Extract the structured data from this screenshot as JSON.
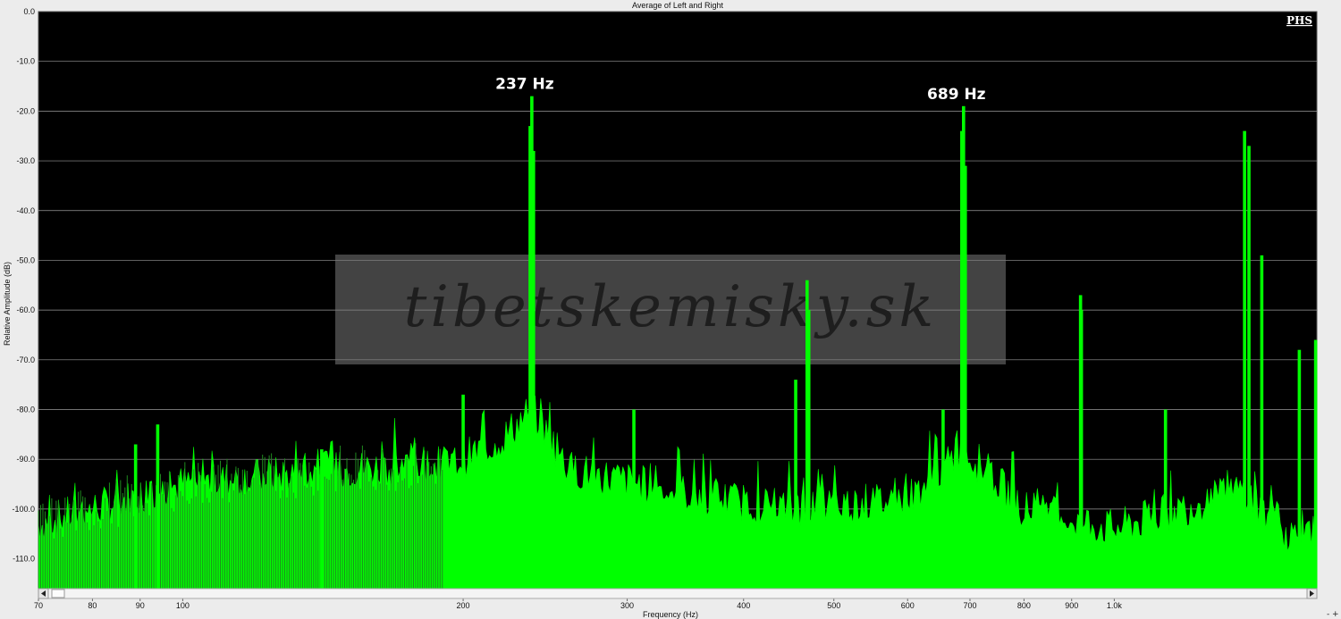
{
  "chart_data": {
    "type": "area",
    "title": "Average of Left and Right",
    "xlabel": "Frequency (Hz)",
    "ylabel": "Relative Amplitude (dB)",
    "x_scale": "log",
    "xlim": [
      70,
      1650
    ],
    "ylim": [
      -116,
      0
    ],
    "grid": true,
    "series_color": "#00ff00",
    "x_ticks": [
      {
        "value": 70,
        "label": "70"
      },
      {
        "value": 80,
        "label": "80"
      },
      {
        "value": 90,
        "label": "90"
      },
      {
        "value": 100,
        "label": "100"
      },
      {
        "value": 200,
        "label": "200"
      },
      {
        "value": 300,
        "label": "300"
      },
      {
        "value": 400,
        "label": "400"
      },
      {
        "value": 500,
        "label": "500"
      },
      {
        "value": 600,
        "label": "600"
      },
      {
        "value": 700,
        "label": "700"
      },
      {
        "value": 800,
        "label": "800"
      },
      {
        "value": 900,
        "label": "900"
      },
      {
        "value": 1000,
        "label": "1.0k"
      }
    ],
    "y_ticks": [
      {
        "value": 0,
        "label": "0.0"
      },
      {
        "value": -10,
        "label": "-10.0"
      },
      {
        "value": -20,
        "label": "-20.0"
      },
      {
        "value": -30,
        "label": "-30.0"
      },
      {
        "value": -40,
        "label": "-40.0"
      },
      {
        "value": -50,
        "label": "-50.0"
      },
      {
        "value": -60,
        "label": "-60.0"
      },
      {
        "value": -70,
        "label": "-70.0"
      },
      {
        "value": -80,
        "label": "-80.0"
      },
      {
        "value": -90,
        "label": "-90.0"
      },
      {
        "value": -100,
        "label": "-100.0"
      },
      {
        "value": -110,
        "label": "-110.0"
      }
    ],
    "peaks": [
      {
        "freq": 200,
        "db": -77
      },
      {
        "freq": 237,
        "db": -17
      },
      {
        "freq": 236,
        "db": -23
      },
      {
        "freq": 238,
        "db": -28
      },
      {
        "freq": 305,
        "db": -80
      },
      {
        "freq": 468,
        "db": -54
      },
      {
        "freq": 470,
        "db": -60
      },
      {
        "freq": 455,
        "db": -74
      },
      {
        "freq": 689,
        "db": -19
      },
      {
        "freq": 686,
        "db": -24
      },
      {
        "freq": 692,
        "db": -31
      },
      {
        "freq": 655,
        "db": -80
      },
      {
        "freq": 920,
        "db": -57
      },
      {
        "freq": 922,
        "db": -60
      },
      {
        "freq": 1135,
        "db": -80
      },
      {
        "freq": 1380,
        "db": -24
      },
      {
        "freq": 1395,
        "db": -27
      },
      {
        "freq": 1440,
        "db": -49
      },
      {
        "freq": 1580,
        "db": -68
      },
      {
        "freq": 1645,
        "db": -66
      },
      {
        "freq": 89,
        "db": -87
      },
      {
        "freq": 94,
        "db": -83
      },
      {
        "freq": 141,
        "db": -88
      }
    ],
    "noise_floor": [
      {
        "freq": 70,
        "db": -103
      },
      {
        "freq": 100,
        "db": -95
      },
      {
        "freq": 150,
        "db": -92
      },
      {
        "freq": 195,
        "db": -91
      },
      {
        "freq": 220,
        "db": -86
      },
      {
        "freq": 237,
        "db": -80
      },
      {
        "freq": 260,
        "db": -92
      },
      {
        "freq": 350,
        "db": -97
      },
      {
        "freq": 450,
        "db": -100
      },
      {
        "freq": 600,
        "db": -98
      },
      {
        "freq": 689,
        "db": -88
      },
      {
        "freq": 800,
        "db": -100
      },
      {
        "freq": 1000,
        "db": -104
      },
      {
        "freq": 1380,
        "db": -96
      },
      {
        "freq": 1500,
        "db": -104
      },
      {
        "freq": 1650,
        "db": -107
      }
    ],
    "annotations": [
      {
        "label": "237 Hz",
        "freq": 237
      },
      {
        "label": "689 Hz",
        "freq": 689
      }
    ]
  },
  "watermark": "tibetskemisky.sk",
  "logo": "PHS"
}
